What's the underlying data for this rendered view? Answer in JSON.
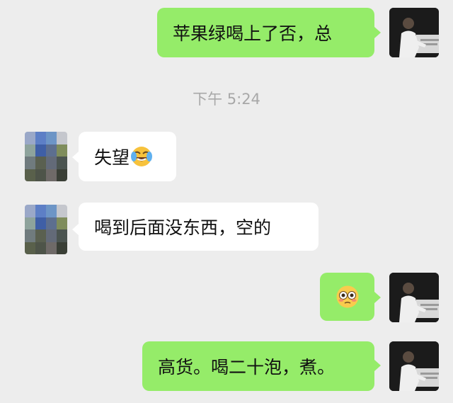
{
  "chat": {
    "timestamp": "下午 5:24",
    "messages": [
      {
        "sender": "me",
        "text": "苹果绿喝上了否，总"
      },
      {
        "sender": "other",
        "text": "失望",
        "emoji": "crying-laughing-emoji"
      },
      {
        "sender": "other",
        "text": "喝到后面没东西，空的"
      },
      {
        "sender": "me",
        "text": "",
        "emoji": "flushed-face-emoji"
      },
      {
        "sender": "me",
        "text": "高货。喝二十泡，煮。"
      }
    ]
  },
  "colors": {
    "background": "#ededed",
    "outgoing_bubble": "#95ec69",
    "incoming_bubble": "#ffffff",
    "timestamp_text": "#a8a8a8"
  }
}
